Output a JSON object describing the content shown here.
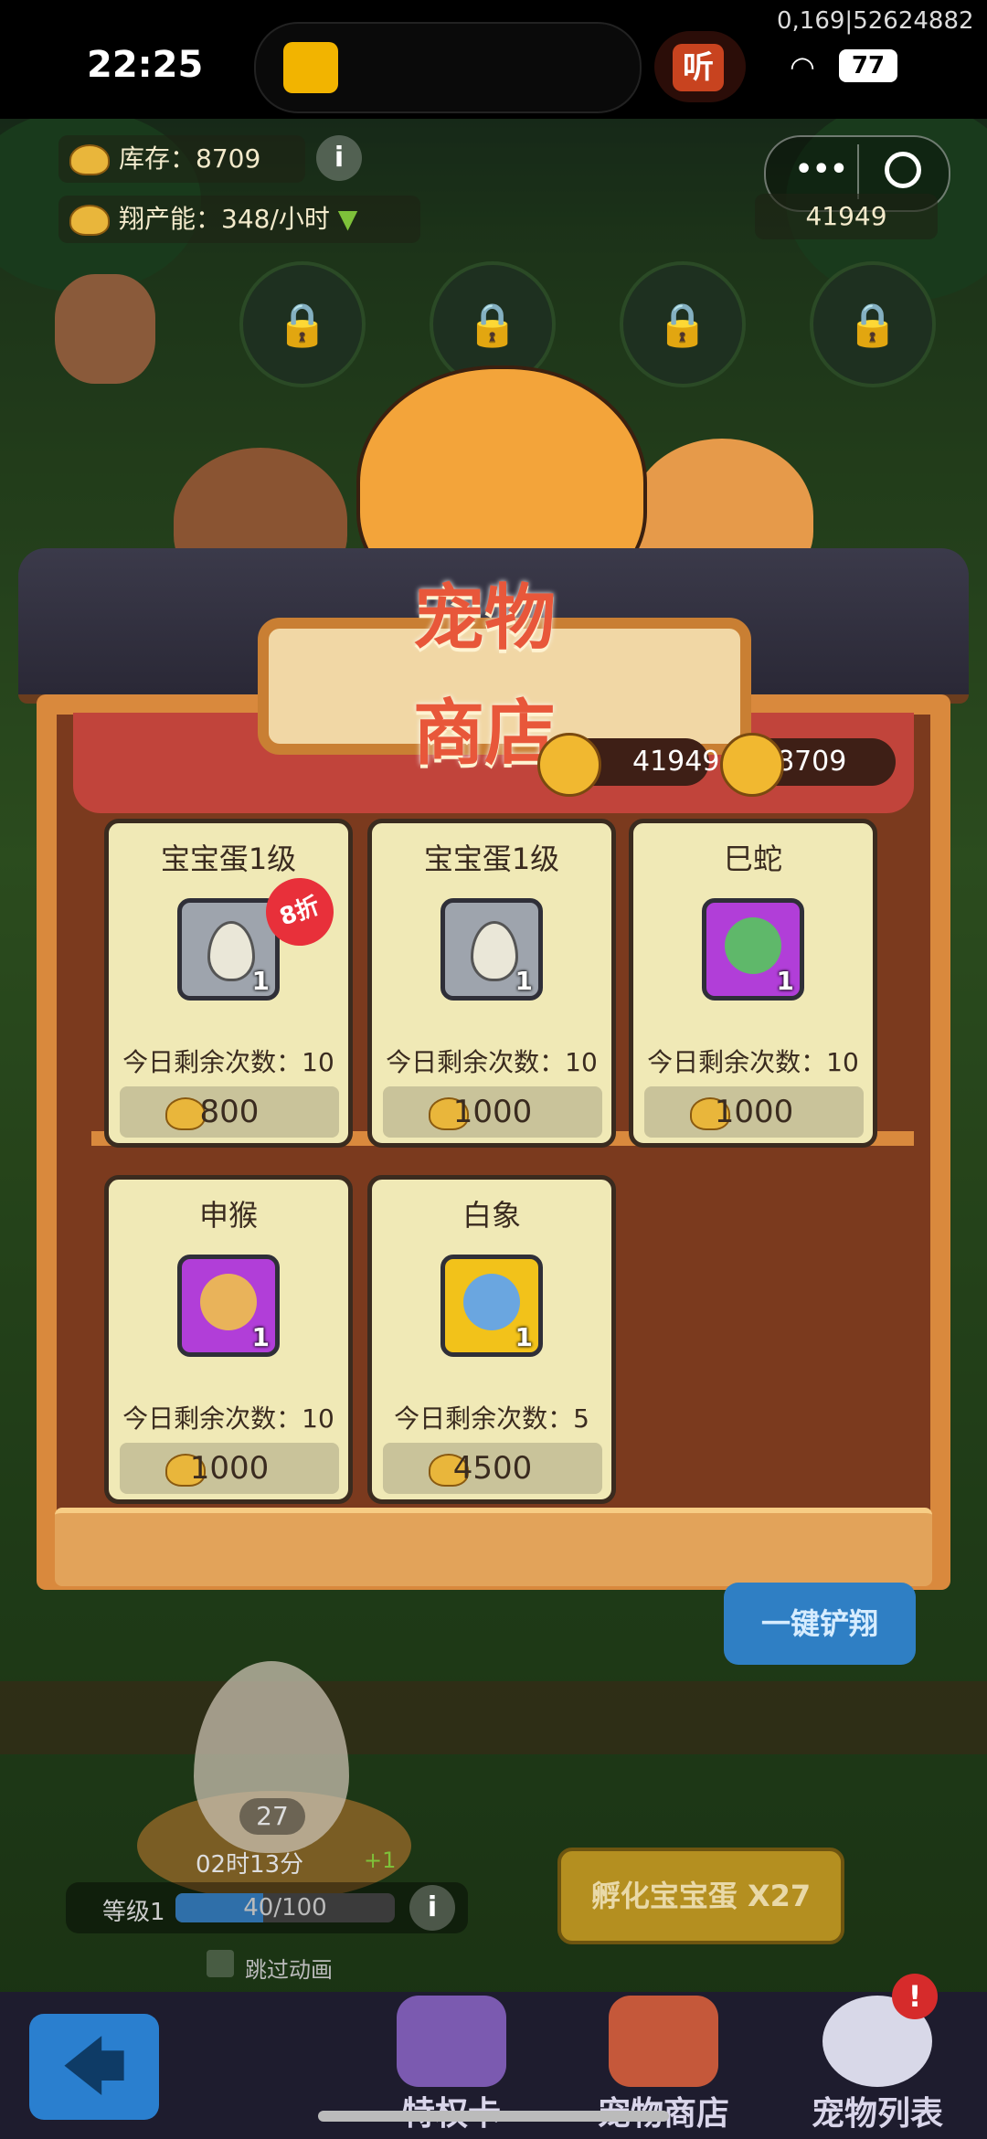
{
  "status": {
    "time": "22:25",
    "corner_id": "0,169|52624882",
    "listen_label": "听",
    "battery": "77"
  },
  "hud": {
    "stock_label": "库存：8709",
    "capacity_label": "翔产能：348/小时",
    "gold_top": "41949",
    "info": "i"
  },
  "shop": {
    "title_line1": "宠物",
    "title_line2": "商店",
    "gold": "41949",
    "stock": "8709",
    "items": [
      {
        "name": "宝宝蛋1级",
        "qty": "1",
        "remaining": "今日剩余次数：10",
        "price": "800",
        "discount": "8折"
      },
      {
        "name": "宝宝蛋1级",
        "qty": "1",
        "remaining": "今日剩余次数：10",
        "price": "1000"
      },
      {
        "name": "巳蛇",
        "qty": "1",
        "remaining": "今日剩余次数：10",
        "price": "1000"
      },
      {
        "name": "申猴",
        "qty": "1",
        "remaining": "今日剩余次数：10",
        "price": "1000"
      },
      {
        "name": "白象",
        "qty": "1",
        "remaining": "今日剩余次数：5",
        "price": "4500"
      }
    ]
  },
  "game": {
    "shovel_btn": "一键铲翔",
    "egg_count": "27",
    "timer": "02时13分",
    "plus": "+1",
    "level_label": "等级1",
    "level_progress": "40/100",
    "level_fraction": 0.4,
    "hatch_btn": "孵化宝宝蛋 X27",
    "skip_anim": "跳过动画"
  },
  "nav": {
    "privilege": "特权卡",
    "shop": "宠物商店",
    "petlist": "宠物列表",
    "alert": "!",
    "back_arrow": "🡄"
  },
  "colors": {
    "accent_red": "#e8573a",
    "frame": "#d9893d",
    "card_bg": "#f0e9b6"
  }
}
